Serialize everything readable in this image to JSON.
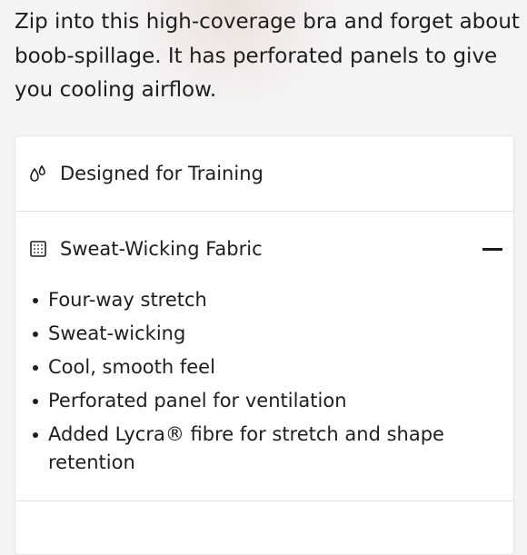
{
  "description": "Zip into this high-coverage bra and forget about boob-spillage. It has perforated panels to give you cooling airflow.",
  "accordion": {
    "items": [
      {
        "title": "Designed for Training",
        "icon": "droplets-icon",
        "expanded": false
      },
      {
        "title": "Sweat-Wicking Fabric",
        "icon": "fabric-swatch-icon",
        "expanded": true,
        "features": [
          "Four-way stretch",
          "Sweat-wicking",
          "Cool, smooth feel",
          "Perforated panel for ventilation",
          "Added Lycra® fibre for stretch and shape retention"
        ]
      }
    ]
  },
  "colors": {
    "text": "#1e1e1e",
    "background": "#f5f4f4",
    "card": "#ffffff",
    "divider": "#e1e1e1"
  }
}
